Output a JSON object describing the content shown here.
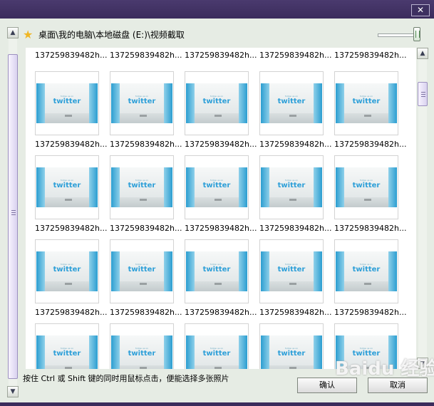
{
  "window": {
    "close_label": "✕"
  },
  "path_bar": {
    "star_icon": "star-icon",
    "path": "桌面\\我的电脑\\本地磁盘 (E:)\\视频截取"
  },
  "thumbnail_caption": "137259839482h...",
  "rows": [
    {
      "captions": [
        "137259839482h...",
        "137259839482h...",
        "137259839482h...",
        "137259839482h...",
        "137259839482h..."
      ]
    },
    {
      "captions": [
        "137259839482h...",
        "137259839482h...",
        "137259839482h...",
        "137259839482h...",
        "137259839482h..."
      ]
    },
    {
      "captions": [
        "137259839482h...",
        "137259839482h...",
        "137259839482h...",
        "137259839482h...",
        "137259839482h..."
      ]
    },
    {
      "captions": [
        "137259839482h...",
        "137259839482h...",
        "137259839482h...",
        "137259839482h...",
        "137259839482h..."
      ]
    },
    {
      "captions": [
        "",
        "",
        "",
        "",
        ""
      ]
    }
  ],
  "thumbnail_text": {
    "follow": "follow us on",
    "brand": "twitter"
  },
  "hint": "按住 Ctrl 或 Shift 键的同时用鼠标点击，便能选择多张照片",
  "buttons": {
    "ok": "确认",
    "cancel": "取消"
  },
  "watermark": "Baidu 经验",
  "colors": {
    "titlebar": "#3b2c5c",
    "panel": "#e6ece4",
    "twitter_blue": "#2d9fd8"
  }
}
